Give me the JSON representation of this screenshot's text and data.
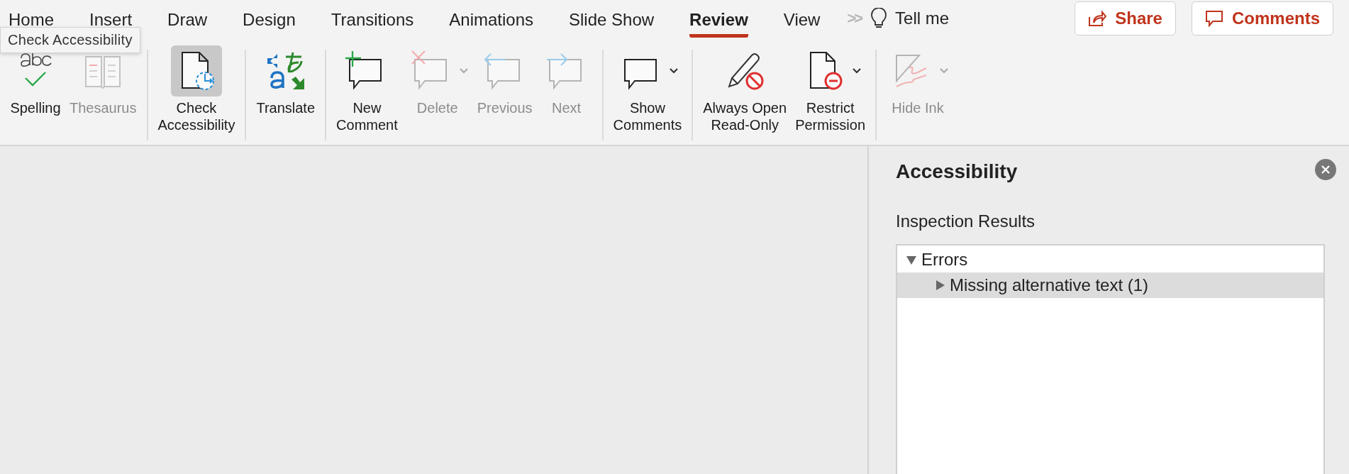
{
  "tabs": [
    {
      "label": "Home",
      "selected": false
    },
    {
      "label": "Insert",
      "selected": false
    },
    {
      "label": "Draw",
      "selected": false
    },
    {
      "label": "Design",
      "selected": false
    },
    {
      "label": "Transitions",
      "selected": false
    },
    {
      "label": "Animations",
      "selected": false
    },
    {
      "label": "Slide Show",
      "selected": false
    },
    {
      "label": "Review",
      "selected": true
    },
    {
      "label": "View",
      "selected": false
    }
  ],
  "overflow": ">>",
  "tell_me": "Tell me",
  "share_button": "Share",
  "comments_button": "Comments",
  "tooltip": "Check Accessibility",
  "ribbon_groups": [
    {
      "items": [
        {
          "kind": "spelling",
          "label": "Spelling",
          "disabled": false,
          "pressed": false,
          "dropdown": false
        },
        {
          "kind": "thesaurus",
          "label": "Thesaurus",
          "disabled": true,
          "pressed": false,
          "dropdown": false
        }
      ]
    },
    {
      "items": [
        {
          "kind": "accessibility",
          "label": "Check\nAccessibility",
          "disabled": false,
          "pressed": true,
          "dropdown": false
        }
      ]
    },
    {
      "items": [
        {
          "kind": "translate",
          "label": "Translate",
          "disabled": false,
          "pressed": false,
          "dropdown": false
        }
      ]
    },
    {
      "items": [
        {
          "kind": "new-comment",
          "label": "New\nComment",
          "disabled": false,
          "pressed": false,
          "dropdown": false
        },
        {
          "kind": "delete",
          "label": "Delete",
          "disabled": true,
          "pressed": false,
          "dropdown": true
        },
        {
          "kind": "previous",
          "label": "Previous",
          "disabled": true,
          "pressed": false,
          "dropdown": false
        },
        {
          "kind": "next",
          "label": "Next",
          "disabled": true,
          "pressed": false,
          "dropdown": false
        }
      ]
    },
    {
      "items": [
        {
          "kind": "show-comments",
          "label": "Show\nComments",
          "disabled": false,
          "pressed": false,
          "dropdown": true
        }
      ]
    },
    {
      "items": [
        {
          "kind": "read-only",
          "label": "Always Open\nRead-Only",
          "disabled": false,
          "pressed": false,
          "dropdown": false
        },
        {
          "kind": "restrict",
          "label": "Restrict\nPermission",
          "disabled": false,
          "pressed": false,
          "dropdown": true
        }
      ]
    },
    {
      "items": [
        {
          "kind": "hide-ink",
          "label": "Hide Ink",
          "disabled": true,
          "pressed": false,
          "dropdown": true
        }
      ]
    }
  ],
  "pane": {
    "title": "Accessibility",
    "section": "Inspection Results",
    "tree": [
      {
        "label": "Errors",
        "expanded": true,
        "selected": false,
        "children": [
          {
            "label": "Missing alternative text (1)",
            "expanded": false,
            "selected": true
          }
        ]
      }
    ]
  }
}
